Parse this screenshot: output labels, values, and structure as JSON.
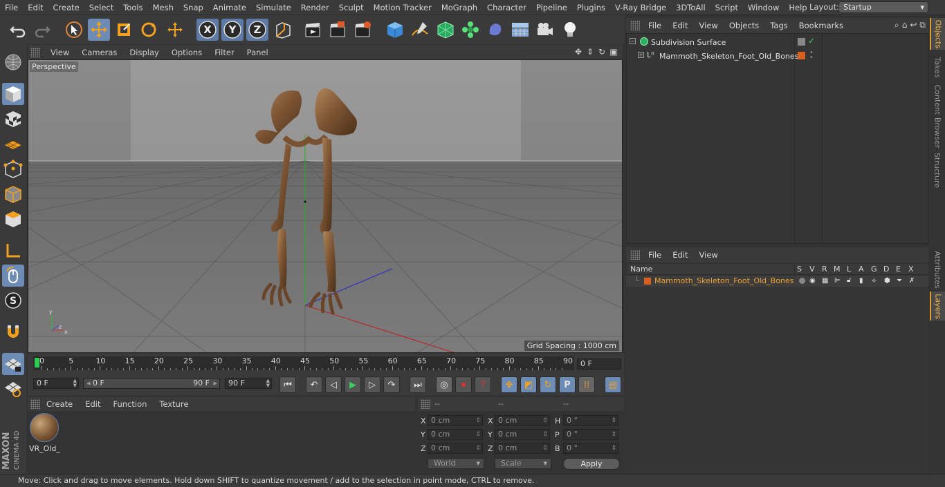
{
  "menu": [
    "File",
    "Edit",
    "Create",
    "Select",
    "Tools",
    "Mesh",
    "Snap",
    "Animate",
    "Simulate",
    "Render",
    "Sculpt",
    "Motion Tracker",
    "MoGraph",
    "Character",
    "Pipeline",
    "Plugins",
    "V-Ray Bridge",
    "3DToAll",
    "Script",
    "Window",
    "Help"
  ],
  "layout": {
    "label": "Layout:",
    "value": "Startup"
  },
  "toolbar": {
    "x_label": "X",
    "y_label": "Y",
    "z_label": "Z"
  },
  "viewport": {
    "menu": [
      "View",
      "Cameras",
      "Display",
      "Options",
      "Filter",
      "Panel"
    ],
    "label": "Perspective",
    "grid_spacing": "Grid Spacing : 1000 cm",
    "axis_y": "y",
    "axis_z": "z",
    "axis_x": "x"
  },
  "timeline": {
    "ticks": [
      "0",
      "5",
      "10",
      "15",
      "20",
      "25",
      "30",
      "35",
      "40",
      "45",
      "50",
      "55",
      "60",
      "65",
      "70",
      "75",
      "80",
      "85",
      "90"
    ],
    "current_frame": "0 F"
  },
  "transport": {
    "start": "0 F",
    "range_start": "0 F",
    "range_end": "90 F",
    "end": "90 F"
  },
  "material_manager": {
    "menu": [
      "Create",
      "Edit",
      "Function",
      "Texture"
    ],
    "material_name": "VR_Old_"
  },
  "coordinates": {
    "headers": [
      "--",
      "--",
      "--"
    ],
    "pos_labels": [
      "X",
      "Y",
      "Z"
    ],
    "size_labels": [
      "X",
      "Y",
      "Z"
    ],
    "rot_labels": [
      "H",
      "P",
      "B"
    ],
    "pos": [
      "0 cm",
      "0 cm",
      "0 cm"
    ],
    "size": [
      "0 cm",
      "0 cm",
      "0 cm"
    ],
    "rot": [
      "0 °",
      "0 °",
      "0 °"
    ],
    "world": "World",
    "scale": "Scale",
    "apply": "Apply"
  },
  "status": "Move: Click and drag to move elements. Hold down SHIFT to quantize movement / add to the selection in point mode, CTRL to remove.",
  "object_manager": {
    "menu": [
      "File",
      "Edit",
      "View",
      "Objects",
      "Tags",
      "Bookmarks"
    ],
    "objects": [
      {
        "name": "Subdivision Surface"
      },
      {
        "name": "Mammoth_Skeleton_Foot_Old_Bones"
      }
    ]
  },
  "layer_manager": {
    "menu": [
      "File",
      "Edit",
      "View"
    ],
    "name_header": "Name",
    "flags": [
      "S",
      "V",
      "R",
      "M",
      "L",
      "A",
      "G",
      "D",
      "E",
      "X"
    ],
    "layer_name": "Mammoth_Skeleton_Foot_Old_Bones",
    "layer_color": "#d86020"
  },
  "right_tabs": [
    "Objects",
    "Takes",
    "Content Browser",
    "Structure",
    "Attributes",
    "Layers"
  ],
  "logo": {
    "line1": "MAXON",
    "line2": "CINEMA 4D"
  },
  "colors": {
    "accent": "#6c8bb5",
    "highlight": "#f0a030"
  }
}
